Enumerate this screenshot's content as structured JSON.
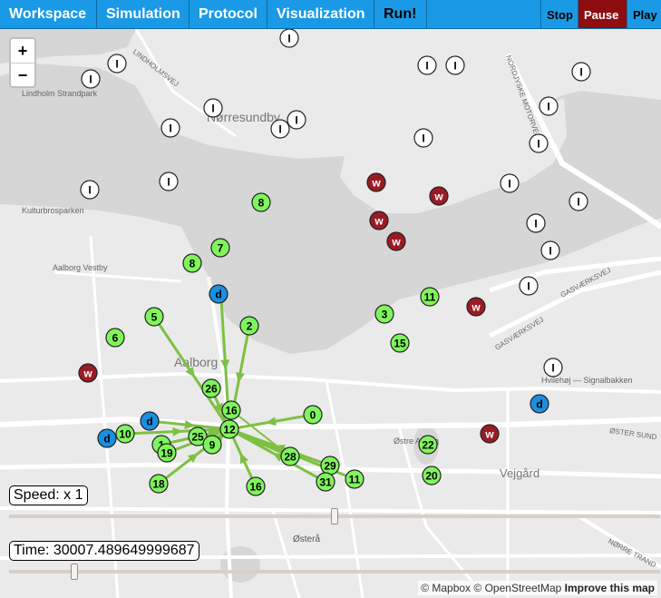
{
  "menu": {
    "tabs": [
      "Workspace",
      "Simulation",
      "Protocol",
      "Visualization",
      "Run!"
    ],
    "controls": [
      "Stop",
      "Pause",
      "Play"
    ]
  },
  "zoom": {
    "in_label": "+",
    "out_label": "−"
  },
  "map_labels": [
    "Lindholm Strandpark",
    "LINDHOLMSVEJ",
    "Nørresundby",
    "NORDJYSKE MOTORVEJ",
    "Kulturbrosparken",
    "Aalborg Vestby",
    "Aalborg",
    "GASVÆRKSVEJ",
    "GASVÆRKSVEJ",
    "Hvilehøj — Signalbakken",
    "ØSTER SUND",
    "Østre Anlæg",
    "Vejgård",
    "Østerå",
    "NØRRE TRAND"
  ],
  "speed": {
    "text": "Speed: x 1",
    "slider_fraction": 0.5
  },
  "time": {
    "text": "Time: 30007.489649999687",
    "slider_fraction": 0.1
  },
  "attribution": {
    "mapbox": "© Mapbox",
    "osm": "© OpenStreetMap",
    "improve": "Improve this map"
  },
  "colors": {
    "menu_bar": "#1a9ae6",
    "pause_active": "#8e0d10",
    "node_green": "#7ff55c",
    "node_blue": "#1a8fe0",
    "node_red": "#9b1b25",
    "node_white": "#ffffff",
    "edge": "#7ec043",
    "water": "#d6d6d6",
    "land": "#eaeaea"
  },
  "nodes": {
    "info": [
      "I",
      "I",
      "I",
      "I",
      "I",
      "I",
      "I",
      "I",
      "I",
      "I",
      "I",
      "I",
      "I",
      "I",
      "I",
      "I",
      "I",
      "I",
      "I",
      "I",
      "I",
      "I",
      "I",
      "I"
    ],
    "warehouse": [
      "w",
      "w",
      "w",
      "w",
      "w",
      "w",
      "w",
      "w"
    ],
    "depot": [
      "d",
      "d",
      "d",
      "d"
    ],
    "agents": [
      "8",
      "7",
      "8",
      "5",
      "6",
      "2",
      "26",
      "16",
      "12",
      "0",
      "25",
      "10",
      "1",
      "19",
      "9",
      "18",
      "28",
      "29",
      "31",
      "11",
      "16",
      "3",
      "15",
      "11",
      "22",
      "20"
    ]
  }
}
